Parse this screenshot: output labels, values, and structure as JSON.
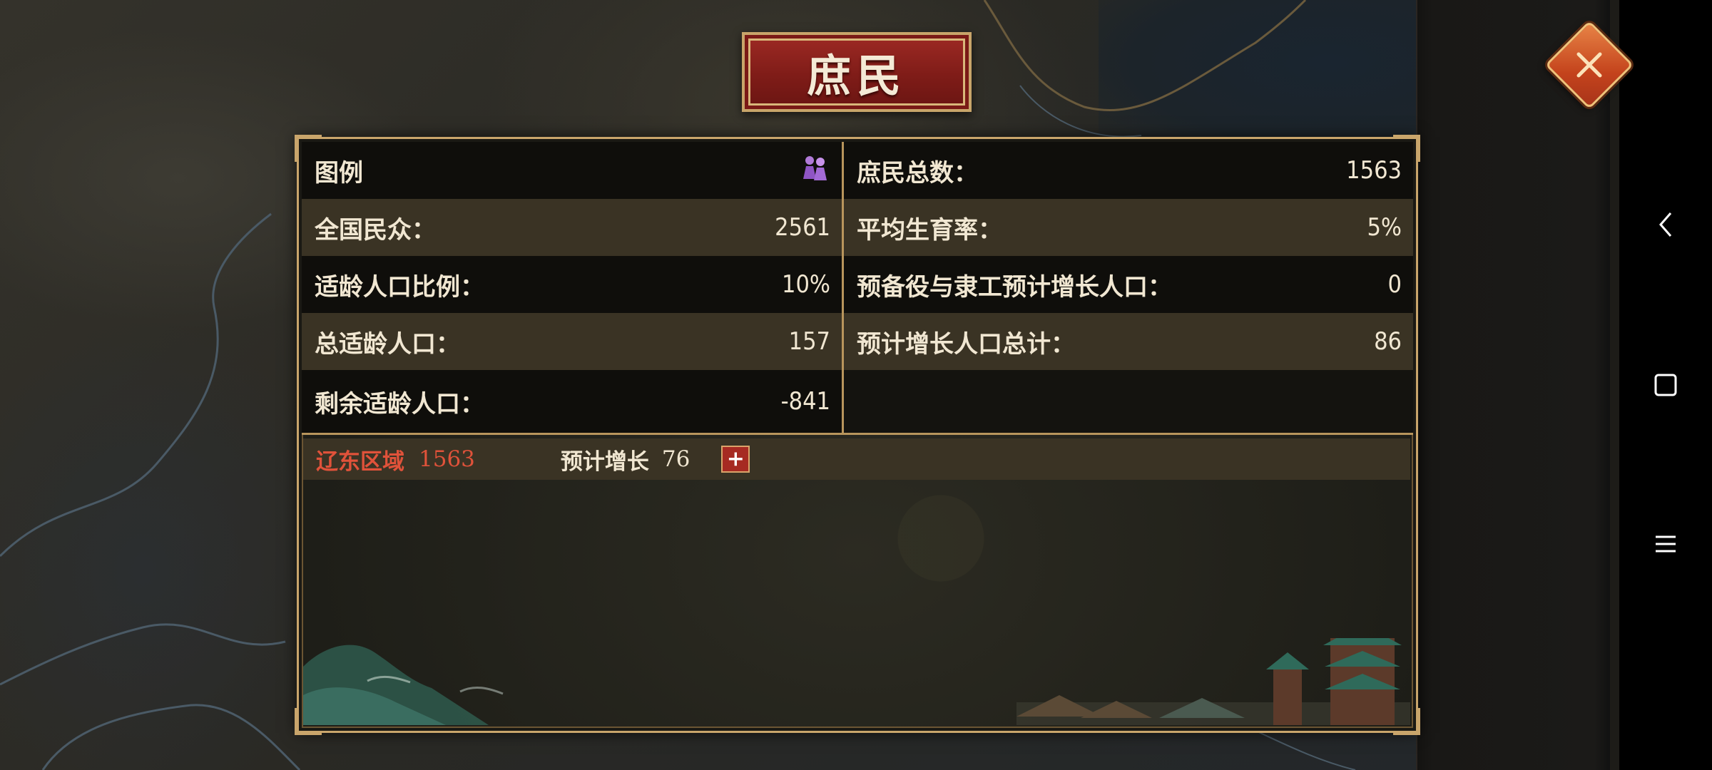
{
  "title": "庶民",
  "close_icon": "close-x-icon",
  "legend": {
    "label": "图例",
    "icon": "people-figures-icon"
  },
  "left_stats": [
    {
      "label": "全国民众：",
      "value": "2561"
    },
    {
      "label": "适龄人口比例：",
      "value": "10%"
    },
    {
      "label": "总适龄人口：",
      "value": "157"
    },
    {
      "label": "剩余适龄人口：",
      "value": "-841"
    }
  ],
  "right_stats": [
    {
      "label": "庶民总数：",
      "value": "1563"
    },
    {
      "label": "平均生育率：",
      "value": "5%"
    },
    {
      "label": "预备役与隶工预计增长人口：",
      "value": "0"
    },
    {
      "label": "预计增长人口总计：",
      "value": "86"
    }
  ],
  "region": {
    "name": "辽东区域",
    "count": "1563",
    "growth_label": "预计增长",
    "growth_value": "76",
    "plus": "+"
  },
  "colors": {
    "accent_red": "#e0523a",
    "gold_border": "#c9a56b",
    "plaque_red": "#8a201b"
  }
}
